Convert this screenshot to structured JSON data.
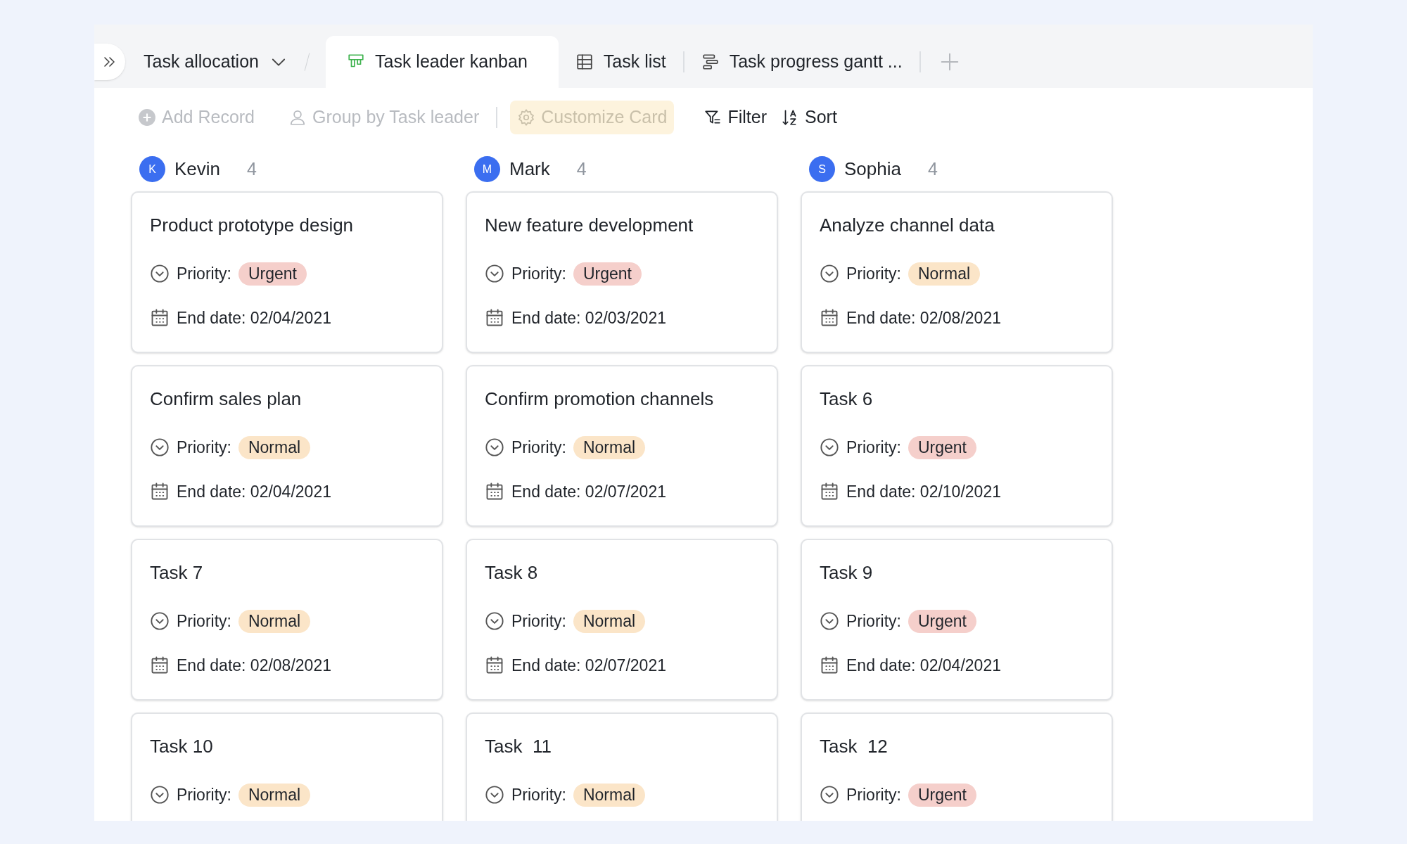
{
  "view_title": "Task allocation",
  "tabs": [
    {
      "label": "Task leader kanban",
      "selected": true
    },
    {
      "label": "Task list",
      "selected": false
    },
    {
      "label": "Task progress gantt ...",
      "selected": false
    }
  ],
  "toolbar": [
    {
      "label": "Add Record",
      "disabled": true
    },
    {
      "label": "Group by Task leader",
      "disabled": true
    },
    {
      "label": "Customize Card",
      "disabled": true
    },
    {
      "label": "Filter",
      "disabled": false
    },
    {
      "label": "Sort",
      "disabled": false
    }
  ],
  "columns": [
    {
      "initial": "K",
      "name": "Kevin",
      "count": "4",
      "cards": [
        {
          "title": "Product prototype design",
          "priority_label": "Priority:",
          "priority": "Urgent",
          "kind": "urgent",
          "date_label": "End date:",
          "end_date": "02/04/2021"
        },
        {
          "title": "Confirm sales plan",
          "priority_label": "Priority:",
          "priority": "Normal",
          "kind": "normal",
          "date_label": "End date:",
          "end_date": "02/04/2021"
        },
        {
          "title": "Task 7",
          "priority_label": "Priority:",
          "priority": "Normal",
          "kind": "normal",
          "date_label": "End date:",
          "end_date": "02/08/2021"
        },
        {
          "title": "Task 10",
          "priority_label": "Priority:",
          "priority": "Normal",
          "kind": "normal"
        }
      ]
    },
    {
      "initial": "M",
      "name": "Mark",
      "count": "4",
      "cards": [
        {
          "title": "New feature development",
          "priority_label": "Priority:",
          "priority": "Urgent",
          "kind": "urgent",
          "date_label": "End date:",
          "end_date": "02/03/2021"
        },
        {
          "title": "Confirm promotion channels",
          "priority_label": "Priority:",
          "priority": "Normal",
          "kind": "normal",
          "date_label": "End date:",
          "end_date": "02/07/2021"
        },
        {
          "title": "Task 8",
          "priority_label": "Priority:",
          "priority": "Normal",
          "kind": "normal",
          "date_label": "End date:",
          "end_date": "02/07/2021"
        },
        {
          "title": "Task  11",
          "priority_label": "Priority:",
          "priority": "Normal",
          "kind": "normal"
        }
      ]
    },
    {
      "initial": "S",
      "name": "Sophia",
      "count": "4",
      "cards": [
        {
          "title": "Analyze channel data",
          "priority_label": "Priority:",
          "priority": "Normal",
          "kind": "normal",
          "date_label": "End date:",
          "end_date": "02/08/2021"
        },
        {
          "title": "Task 6",
          "priority_label": "Priority:",
          "priority": "Urgent",
          "kind": "urgent",
          "date_label": "End date:",
          "end_date": "02/10/2021"
        },
        {
          "title": "Task 9",
          "priority_label": "Priority:",
          "priority": "Urgent",
          "kind": "urgent",
          "date_label": "End date:",
          "end_date": "02/04/2021"
        },
        {
          "title": "Task  12",
          "priority_label": "Priority:",
          "priority": "Urgent",
          "kind": "urgent"
        }
      ]
    }
  ]
}
